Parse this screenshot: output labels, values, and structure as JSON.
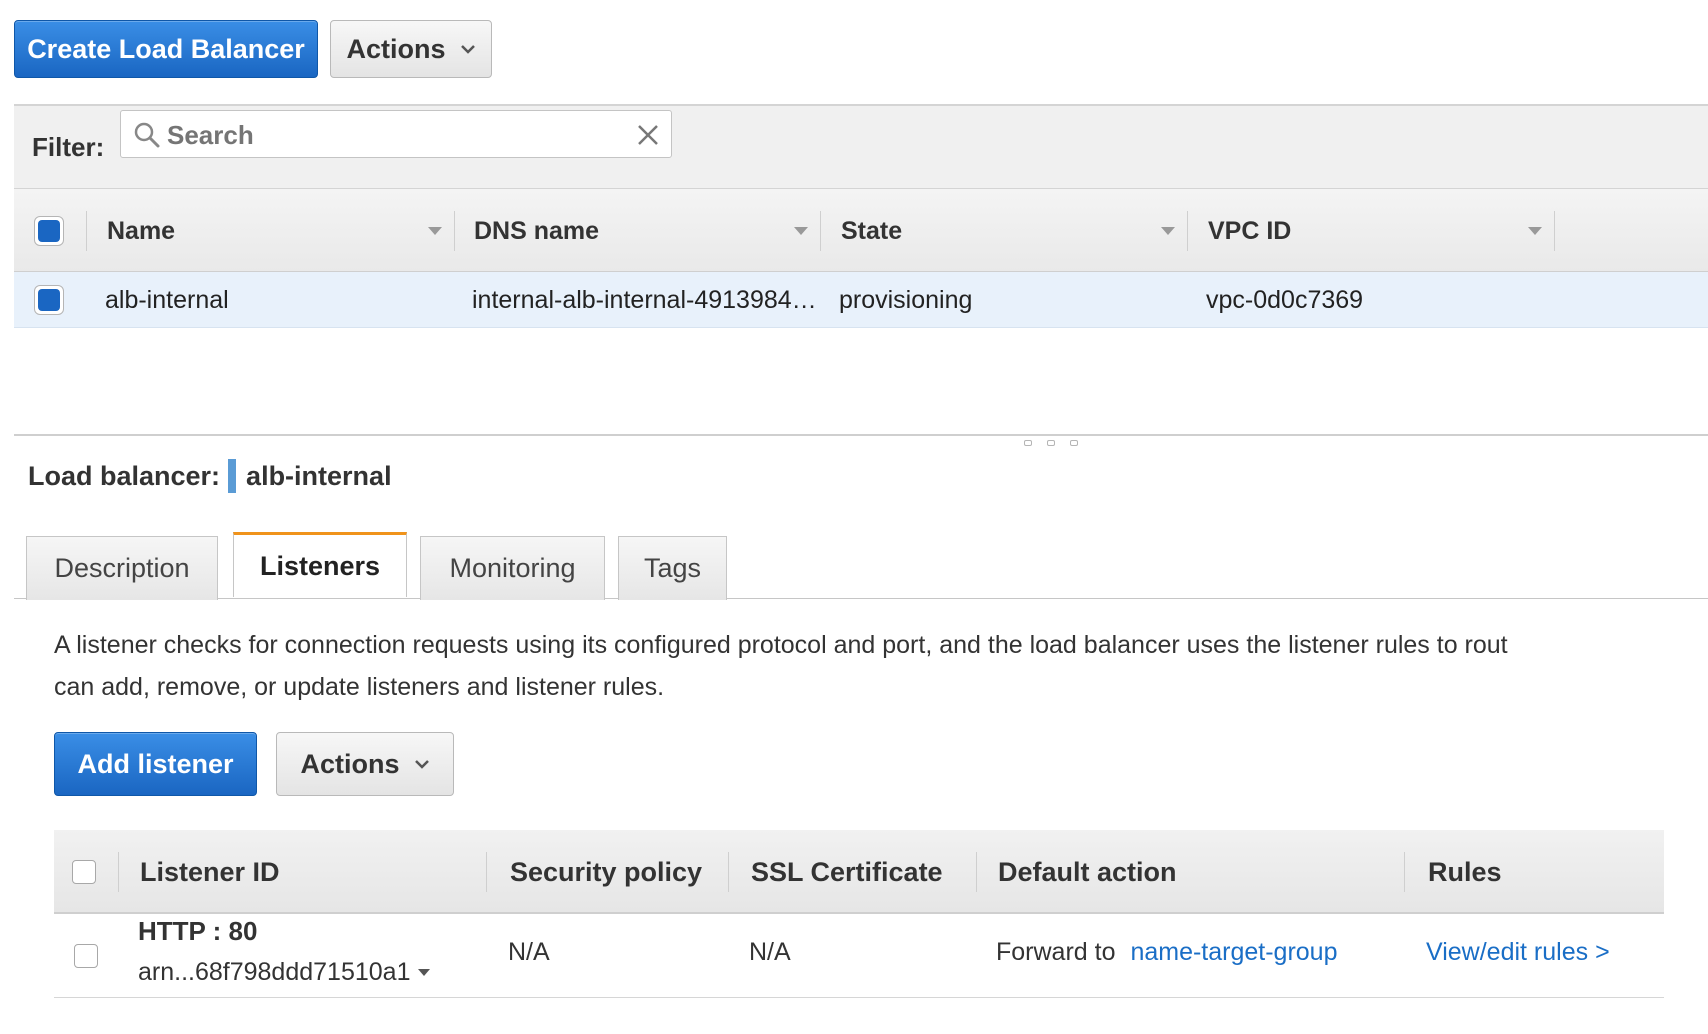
{
  "toolbar": {
    "create_label": "Create Load Balancer",
    "actions_label": "Actions"
  },
  "filter": {
    "label": "Filter:",
    "placeholder": "Search"
  },
  "table": {
    "columns": [
      "Name",
      "DNS name",
      "State",
      "VPC ID"
    ],
    "rows": [
      {
        "name": "alb-internal",
        "dns": "internal-alb-internal-4913984…",
        "state": "provisioning",
        "vpc": "vpc-0d0c7369"
      }
    ]
  },
  "detail": {
    "label": "Load balancer:",
    "name": "alb-internal",
    "tabs": [
      "Description",
      "Listeners",
      "Monitoring",
      "Tags"
    ],
    "active_tab": "Listeners",
    "description_line1": "A listener checks for connection requests using its configured protocol and port, and the load balancer uses the listener rules to rout",
    "description_line2": "can add, remove, or update listeners and listener rules.",
    "add_listener_label": "Add listener",
    "actions_label": "Actions"
  },
  "listeners": {
    "columns": [
      "Listener ID",
      "Security policy",
      "SSL Certificate",
      "Default action",
      "Rules"
    ],
    "rows": [
      {
        "protocol_port": "HTTP : 80",
        "arn": "arn...68f798ddd71510a1",
        "security_policy": "N/A",
        "ssl_certificate": "N/A",
        "default_action_prefix": "Forward to",
        "target_group": "name-target-group",
        "rules_link": "View/edit rules >"
      }
    ]
  },
  "colors": {
    "primary": "#1a66c2",
    "link": "#1a6ec6",
    "active_tab_accent": "#f0931b",
    "selected_row": "#e8f1fb"
  }
}
